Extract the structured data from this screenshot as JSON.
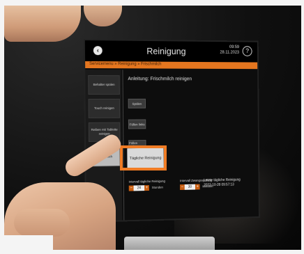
{
  "header": {
    "title": "Reinigung",
    "time": "09:59",
    "date": "28.11.2023",
    "help_label": "?"
  },
  "breadcrumb": "Servicemenu » Reinigung » Frischmilch",
  "sidebar": {
    "items": [
      {
        "label": "Behalter spülen"
      },
      {
        "label": "Touch reinigen"
      },
      {
        "label": "Reiben mit Tablette reinigen"
      },
      {
        "label": "Frischmilch"
      }
    ]
  },
  "main": {
    "heading": "Anleitung: Frischmilch reinigen",
    "buttons": [
      {
        "label": "Spülen"
      },
      {
        "label": "Füllen links"
      },
      {
        "label": "Füllen rechts"
      }
    ],
    "daily_button": "Tägliche Reinigung",
    "last_cleaning_label": "Letzte tägliche Reinigung",
    "last_cleaning_value": "2023-10-28 09:57:13",
    "interval_daily": {
      "label": "Intervall tägliche Reinigung",
      "value": "24",
      "unit": "Stunden"
    },
    "interval_forced": {
      "label": "Intervall Zwangsspülung",
      "value": "30",
      "unit": "Minuten"
    }
  },
  "colors": {
    "accent": "#e5761f",
    "highlight": "#f07c25",
    "background": "#0d0d0d"
  }
}
